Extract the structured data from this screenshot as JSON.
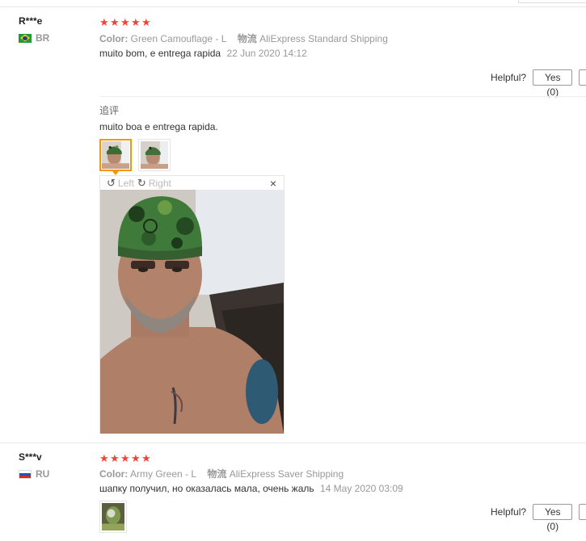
{
  "reviews": [
    {
      "user": "R***e",
      "country": "BR",
      "stars": [
        "★",
        "★",
        "★",
        "★",
        "★"
      ],
      "color_label": "Color:",
      "color_value": "Green Camouflage - L",
      "shipping_label": "物流",
      "shipping_value": "AliExpress Standard Shipping",
      "text": "muito bom, e entrega rapida",
      "date": "22 Jun 2020 14:12",
      "helpful_label": "Helpful?",
      "yes_label": "Yes (0)",
      "followup_title": "追评",
      "followup_text": "muito boa e entrega rapida.",
      "viewer": {
        "rotate_left": "Left",
        "rotate_right": "Right",
        "close": "×"
      }
    },
    {
      "user": "S***v",
      "country": "RU",
      "stars": [
        "★",
        "★",
        "★",
        "★",
        "★"
      ],
      "color_label": "Color:",
      "color_value": "Army Green - L",
      "shipping_label": "物流",
      "shipping_value": "AliExpress Saver Shipping",
      "text": "шапку получил, но оказалась мала, очень жаль",
      "date": "14 May 2020 03:09",
      "helpful_label": "Helpful?",
      "yes_label": "Yes (0)"
    }
  ],
  "icons": {
    "star": "star-icon",
    "rotate_left": "rotate-left-icon",
    "rotate_right": "rotate-right-icon",
    "close": "close-icon"
  },
  "colors": {
    "star": "#f44336",
    "active_thumb": "#f39800",
    "muted_text": "#999999"
  }
}
